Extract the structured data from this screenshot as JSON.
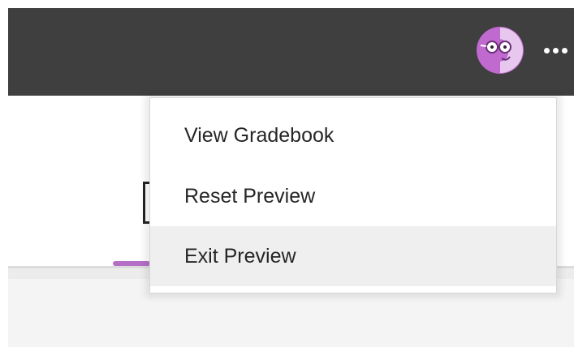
{
  "header": {
    "avatar_icon": "professor-avatar-icon",
    "more_icon": "more-horizontal-icon"
  },
  "menu": {
    "items": [
      {
        "label": "View Gradebook"
      },
      {
        "label": "Reset Preview"
      },
      {
        "label": "Exit Preview",
        "highlighted": true
      }
    ]
  },
  "colors": {
    "header_bg": "#3f3f3f",
    "avatar_purple": "#c06ad0",
    "tab_indicator": "#b56fc6",
    "menu_highlight": "#efefef"
  }
}
